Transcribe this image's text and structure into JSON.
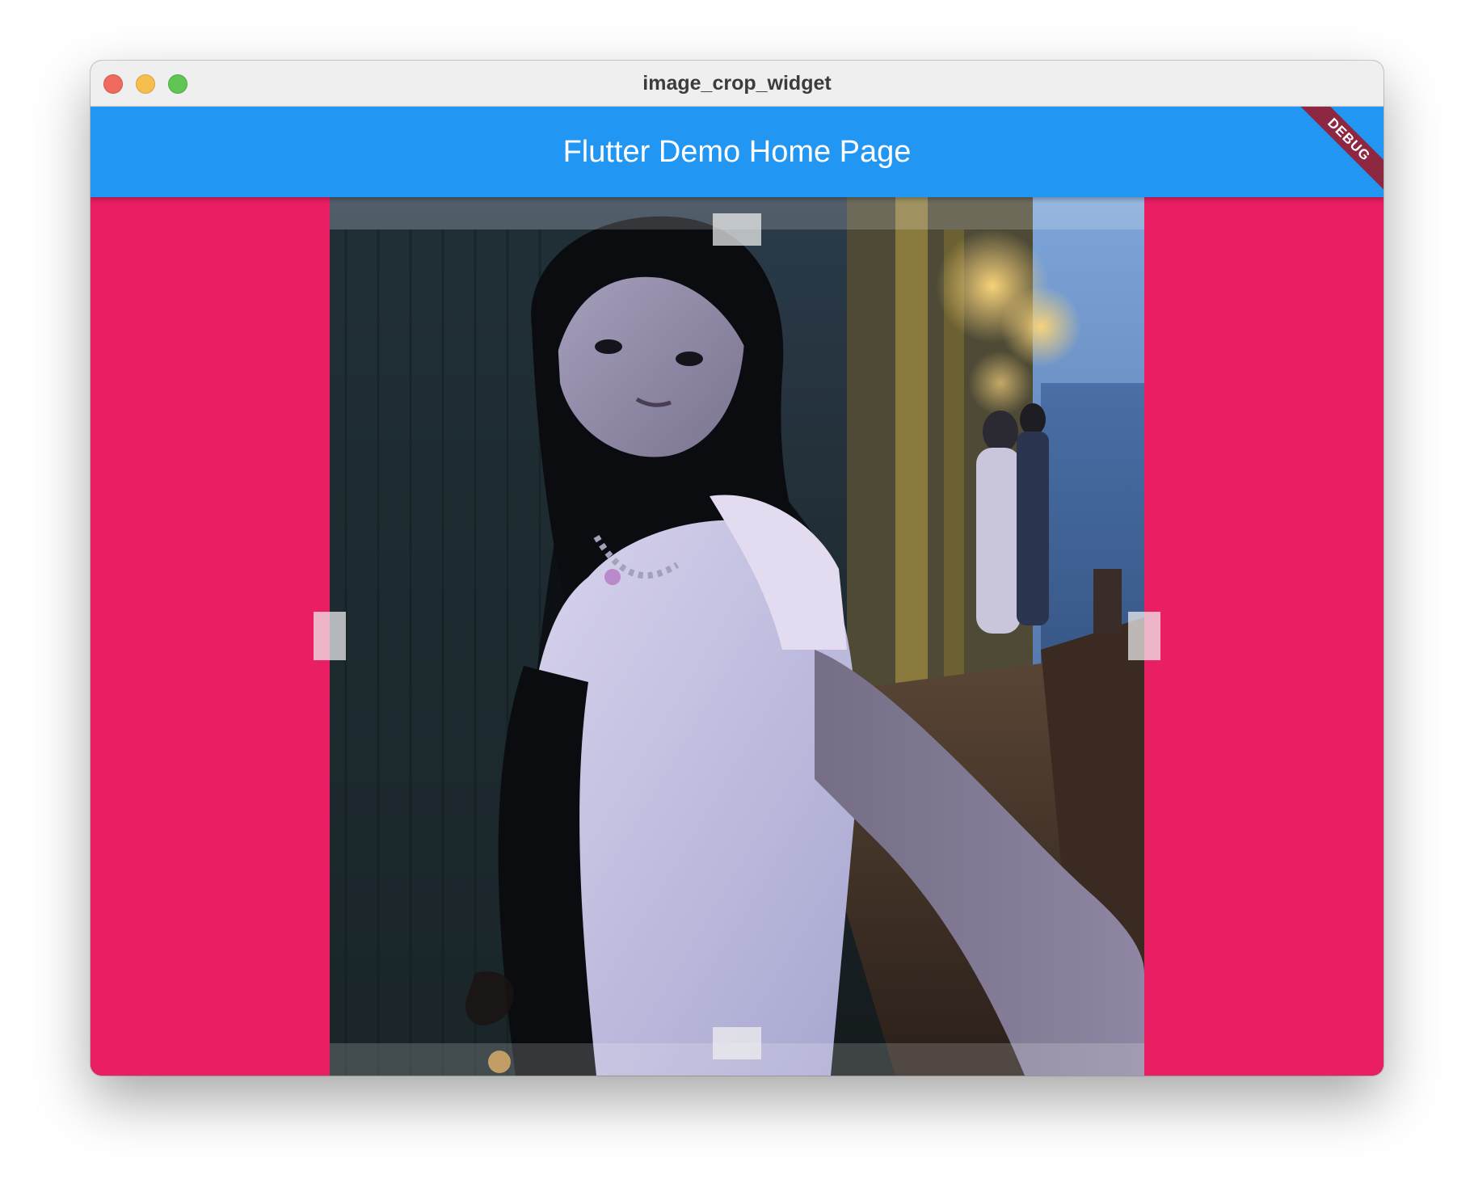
{
  "window": {
    "title": "image_crop_widget"
  },
  "appbar": {
    "title": "Flutter Demo Home Page"
  },
  "debug_banner": {
    "label": "DEBUG"
  },
  "colors": {
    "background": "#e91e63",
    "appbar": "#2196f3",
    "debug_banner": "#8e2741",
    "titlebar": "#eeefee"
  },
  "icons": {
    "close": "close-traffic-light-icon",
    "minimize": "minimize-traffic-light-icon",
    "maximize": "maximize-traffic-light-icon"
  }
}
